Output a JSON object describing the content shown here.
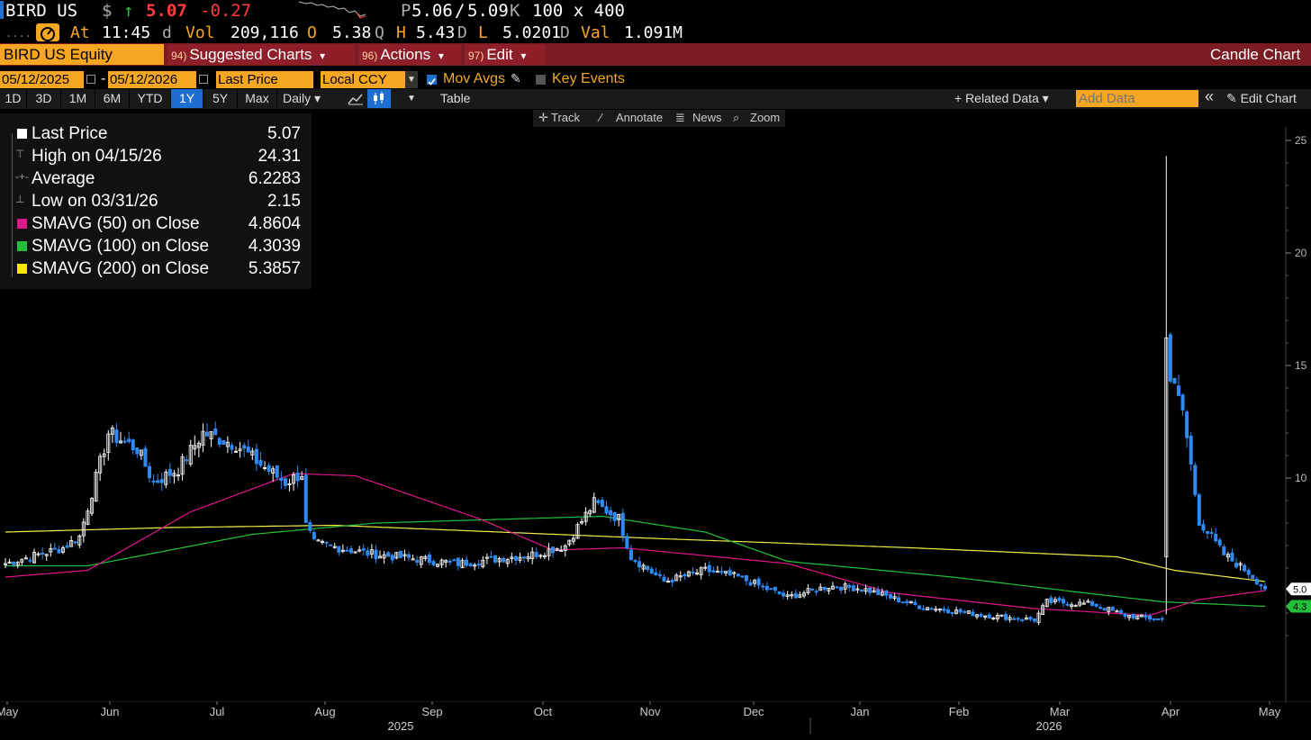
{
  "header": {
    "ticker": "BIRD US",
    "currency_symbol": "$",
    "arrow": "↑",
    "last_price": "5.07",
    "change": "-0.27",
    "bid_label": "P",
    "bid": "5.06",
    "separator": "/",
    "ask": "5.09",
    "ask_suffix": "K",
    "size": "100 x 400",
    "time_label": "At",
    "time": "11:45",
    "time_suffix": "d",
    "vol_label": "Vol",
    "volume": "209,116",
    "open_label": "O",
    "open": "5.38",
    "open_suffix": "Q",
    "high_label": "H",
    "high": "5.43",
    "high_suffix": "D",
    "low_label": "L",
    "low": "5.0201",
    "low_suffix": "D",
    "val_label": "Val",
    "value": "1.091M"
  },
  "function_bar": {
    "security": "BIRD US Equity",
    "suggested_num": "94)",
    "suggested": "Suggested Charts",
    "actions_num": "96)",
    "actions": "Actions",
    "edit_num": "97)",
    "edit": "Edit",
    "dropdown": "▾",
    "chart_type": "Candle Chart"
  },
  "controls": {
    "start_date": "05/12/2025",
    "dash": "-",
    "end_date": "05/12/2026",
    "field": "Last Price",
    "currency": "Local CCY",
    "mov_avgs": "Mov Avgs",
    "key_events": "Key Events"
  },
  "periods": [
    "1D",
    "3D",
    "1M",
    "6M",
    "YTD",
    "1Y",
    "5Y",
    "Max"
  ],
  "selected_period": "1Y",
  "toolbar": {
    "frequency": "Daily ▾",
    "table": "Table",
    "related": "+ Related Data ▾",
    "add_data_placeholder": "Add Data",
    "collapse": "«",
    "edit_chart": "✎ Edit Chart"
  },
  "chart_tools": {
    "track": "Track",
    "annotate": "Annotate",
    "news": "News",
    "zoom": "Zoom"
  },
  "legend": [
    {
      "name": "Last Price",
      "value": "5.07",
      "color": "#ffffff",
      "kind": "swatch"
    },
    {
      "name": "High on 04/15/26",
      "value": "24.31",
      "color": "#999999",
      "kind": "high"
    },
    {
      "name": "Average",
      "value": "6.2283",
      "color": "#999999",
      "kind": "avg"
    },
    {
      "name": "Low on 03/31/26",
      "value": "2.15",
      "color": "#999999",
      "kind": "low"
    },
    {
      "name": "SMAVG (50)  on Close",
      "value": "4.8604",
      "color": "#e0178a",
      "kind": "swatch"
    },
    {
      "name": "SMAVG (100)  on Close",
      "value": "4.3039",
      "color": "#22c03a",
      "kind": "swatch"
    },
    {
      "name": "SMAVG (200)  on Close",
      "value": "5.3857",
      "color": "#f5e500",
      "kind": "swatch"
    }
  ],
  "colors": {
    "up": "#ffffff",
    "down": "#2f8af5",
    "sma50": "#e0178a",
    "sma100": "#22c03a",
    "sma200": "#f0ee4a",
    "amber": "#f5a623",
    "bar_red": "#7a1b22"
  },
  "chart_data": {
    "type": "candlestick",
    "y_ticks": [
      "25",
      "20",
      "15",
      "10"
    ],
    "ylim": [
      3,
      26
    ],
    "x_months": [
      "May",
      "Jun",
      "Jul",
      "Aug",
      "Sep",
      "Oct",
      "Nov",
      "Dec",
      "Jan",
      "Feb",
      "Mar",
      "Apr",
      "May"
    ],
    "x_years": [
      "2025",
      "2026"
    ],
    "price_tags": [
      {
        "value": "5.0",
        "color": "#ffffff"
      },
      {
        "value": "4.3",
        "color": "#22c03a"
      }
    ],
    "last_close": 5.07,
    "closes_anchor": [
      {
        "day": 0,
        "close": 6.2
      },
      {
        "day": 14,
        "close": 6.9
      },
      {
        "day": 18,
        "close": 7.4
      },
      {
        "day": 22,
        "close": 10.0
      },
      {
        "day": 25,
        "close": 12.0
      },
      {
        "day": 32,
        "close": 11.3
      },
      {
        "day": 36,
        "close": 9.8
      },
      {
        "day": 42,
        "close": 10.4
      },
      {
        "day": 48,
        "close": 12.0
      },
      {
        "day": 56,
        "close": 11.5
      },
      {
        "day": 62,
        "close": 10.6
      },
      {
        "day": 68,
        "close": 9.8
      },
      {
        "day": 72,
        "close": 10.2
      },
      {
        "day": 73,
        "close": 7.9
      },
      {
        "day": 75,
        "close": 7.1
      },
      {
        "day": 90,
        "close": 6.6
      },
      {
        "day": 110,
        "close": 6.2
      },
      {
        "day": 128,
        "close": 6.6
      },
      {
        "day": 136,
        "close": 7.0
      },
      {
        "day": 143,
        "close": 8.9
      },
      {
        "day": 149,
        "close": 8.2
      },
      {
        "day": 152,
        "close": 6.5
      },
      {
        "day": 160,
        "close": 5.4
      },
      {
        "day": 170,
        "close": 5.9
      },
      {
        "day": 178,
        "close": 5.6
      },
      {
        "day": 190,
        "close": 4.7
      },
      {
        "day": 200,
        "close": 5.2
      },
      {
        "day": 208,
        "close": 5.1
      },
      {
        "day": 222,
        "close": 4.3
      },
      {
        "day": 238,
        "close": 3.9
      },
      {
        "day": 250,
        "close": 3.7
      },
      {
        "day": 253,
        "close": 4.5
      },
      {
        "day": 264,
        "close": 4.4
      },
      {
        "day": 272,
        "close": 3.9
      },
      {
        "day": 281,
        "close": 3.7
      },
      {
        "day": 282,
        "close": 16.6
      },
      {
        "day": 283,
        "close": 14.4
      },
      {
        "day": 286,
        "close": 13.0
      },
      {
        "day": 290,
        "close": 8.1
      },
      {
        "day": 296,
        "close": 6.6
      },
      {
        "day": 302,
        "close": 5.8
      },
      {
        "day": 306,
        "close": 5.07
      }
    ],
    "high_point": {
      "day": 282,
      "value": 24.31
    },
    "low_point": {
      "day": 281,
      "value": 2.15
    },
    "sma50_anchor": [
      {
        "day": 0,
        "value": 5.6
      },
      {
        "day": 20,
        "value": 5.9
      },
      {
        "day": 45,
        "value": 8.5
      },
      {
        "day": 70,
        "value": 10.2
      },
      {
        "day": 85,
        "value": 10.1
      },
      {
        "day": 115,
        "value": 8.2
      },
      {
        "day": 133,
        "value": 6.8
      },
      {
        "day": 150,
        "value": 6.9
      },
      {
        "day": 190,
        "value": 6.2
      },
      {
        "day": 215,
        "value": 4.9
      },
      {
        "day": 250,
        "value": 4.2
      },
      {
        "day": 278,
        "value": 3.9
      },
      {
        "day": 290,
        "value": 4.6
      },
      {
        "day": 306,
        "value": 5.0
      }
    ],
    "sma100_anchor": [
      {
        "day": 0,
        "value": 6.1
      },
      {
        "day": 20,
        "value": 6.1
      },
      {
        "day": 60,
        "value": 7.5
      },
      {
        "day": 90,
        "value": 8.0
      },
      {
        "day": 145,
        "value": 8.3
      },
      {
        "day": 170,
        "value": 7.6
      },
      {
        "day": 190,
        "value": 6.3
      },
      {
        "day": 230,
        "value": 5.6
      },
      {
        "day": 262,
        "value": 4.9
      },
      {
        "day": 281,
        "value": 4.5
      },
      {
        "day": 306,
        "value": 4.3
      }
    ],
    "sma200_anchor": [
      {
        "day": 0,
        "value": 7.6
      },
      {
        "day": 40,
        "value": 7.8
      },
      {
        "day": 80,
        "value": 7.9
      },
      {
        "day": 160,
        "value": 7.3
      },
      {
        "day": 220,
        "value": 6.9
      },
      {
        "day": 270,
        "value": 6.5
      },
      {
        "day": 284,
        "value": 5.9
      },
      {
        "day": 306,
        "value": 5.4
      }
    ]
  }
}
